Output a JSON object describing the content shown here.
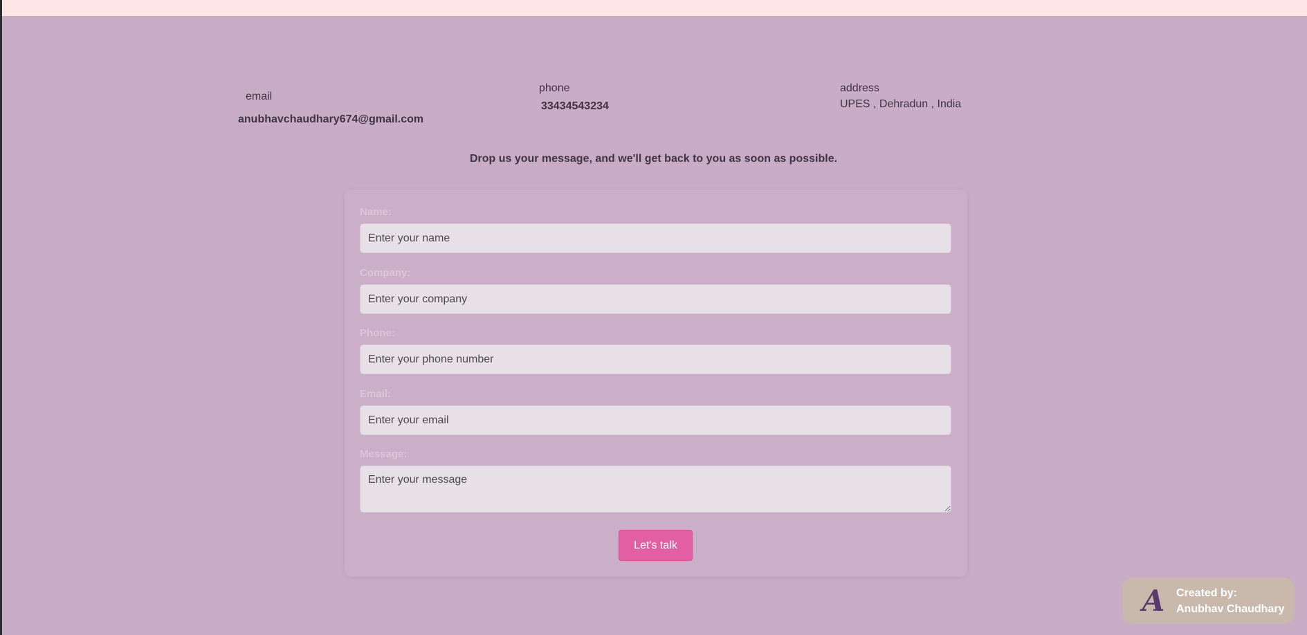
{
  "contact": {
    "email_label": "email",
    "email_value": "anubhavchaudhary674@gmail.com",
    "phone_label": "phone",
    "phone_value": "33434543234",
    "address_label": "address",
    "address_value": "UPES , Dehradun , India"
  },
  "tagline": "Drop us your message, and we'll get back to you as soon as possible.",
  "form": {
    "name_label": "Name:",
    "name_placeholder": "Enter your name",
    "company_label": "Company:",
    "company_placeholder": "Enter your company",
    "phone_label": "Phone:",
    "phone_placeholder": "Enter your phone number",
    "email_label": "Email:",
    "email_placeholder": "Enter your email",
    "message_label": "Message:",
    "message_placeholder": "Enter your message",
    "submit_label": "Let's talk"
  },
  "credit": {
    "logo_letter": "A",
    "line1": "Created by:",
    "line2": "Anubhav Chaudhary"
  },
  "colors": {
    "background": "#c9adc6",
    "top_strip": "#ffe6e6",
    "button": "#e35fa3",
    "badge": "#c9b9ac"
  }
}
